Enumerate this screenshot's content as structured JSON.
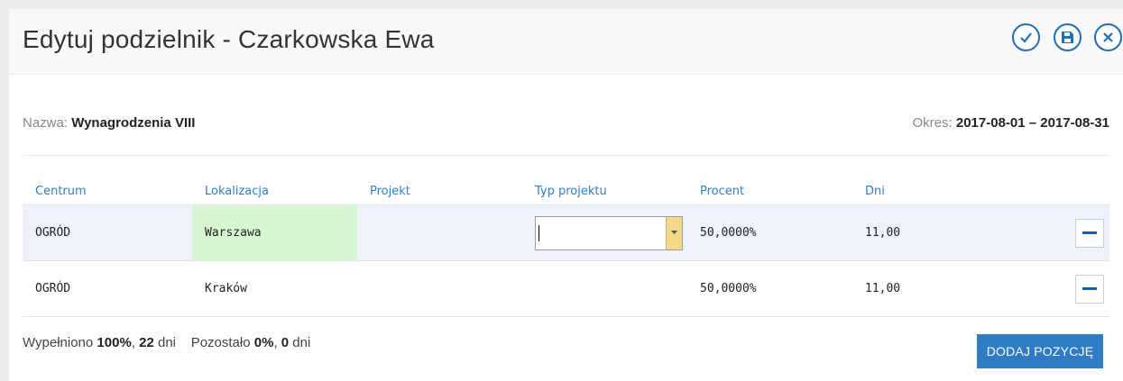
{
  "dialog": {
    "title": "Edytuj podzielnik - Czarkowska Ewa",
    "actions": [
      "confirm-icon",
      "save-icon",
      "close-icon"
    ],
    "accent_color": "#1f6fb8"
  },
  "info": {
    "name_label": "Nazwa:",
    "name_value": "Wynagrodzenia VIII",
    "period_label": "Okres:",
    "period_value": "2017-08-01 – 2017-08-31"
  },
  "table": {
    "headers": [
      "Centrum",
      "Lokalizacja",
      "Projekt",
      "Typ projektu",
      "Procent",
      "Dni"
    ],
    "rows": [
      {
        "centrum": "OGRÓD",
        "lokalizacja": "Warszawa",
        "projekt": "",
        "typ": "",
        "procent": "50,0000%",
        "dni": "11,00"
      },
      {
        "centrum": "OGRÓD",
        "lokalizacja": "Kraków",
        "projekt": "",
        "typ": "",
        "procent": "50,0000%",
        "dni": "11,00"
      }
    ]
  },
  "summary": {
    "filled_label": "Wypełniono",
    "filled_pct": "100%",
    "filled_days": "22",
    "days_unit": "dni",
    "remaining_label": "Pozostało",
    "remaining_pct": "0%",
    "remaining_days": "0"
  },
  "add_button": "DODAJ POZYCJĘ"
}
